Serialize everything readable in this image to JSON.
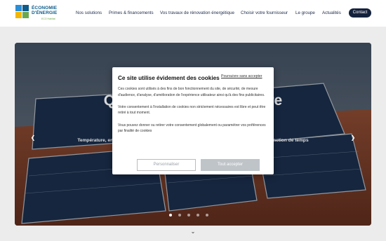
{
  "header": {
    "logo": {
      "line1": "ÉCONOMIE",
      "line2": "D'ÉNERGIE",
      "tagline": "ECO Habitat"
    },
    "nav": [
      {
        "label": "Nos solutions"
      },
      {
        "label": "Primes & financements"
      },
      {
        "label": "Vos travaux de rénovation énergétique"
      },
      {
        "label": "Choisir votre fournisseur"
      },
      {
        "label": "Le groupe"
      },
      {
        "label": "Actualités"
      }
    ],
    "contact_label": "Contact"
  },
  "hero": {
    "title": "Quelle installation solaire",
    "subtitle": "Température, ensoleillement, orientation du toit... les facteurs à prendre en compte, en fonction de temps",
    "prev_icon": "chevron-left-icon",
    "next_icon": "chevron-right-icon",
    "slides_count": 5,
    "active_slide": 1
  },
  "cookie_modal": {
    "title": "Ce site utilise évidement des cookies",
    "skip_label": "Poursuivre sans accepter",
    "paragraphs": [
      "Ces cookies sont utilisés à des fins de bon fonctionnement du site, de sécurité, de mesure d'audience, d'analyse, d'amélioration de l'expérience utilisateur ainsi qu'à des fins publicitaires.",
      "Votre consentement à l'installation de cookies non strictement nécessaires est libre et peut être retiré à tout moment.",
      "Vous pouvez donner ou retirer votre consentement globalement ou paramétrer vos préférences par finalité de cookies"
    ],
    "customize_label": "Personnaliser",
    "accept_label": "Tout accepter"
  },
  "colors": {
    "brand_navy": "#14213d",
    "brand_blue": "#0d5c8c",
    "brand_green": "#6aa84f",
    "accept_bg": "#bfc4c9"
  }
}
